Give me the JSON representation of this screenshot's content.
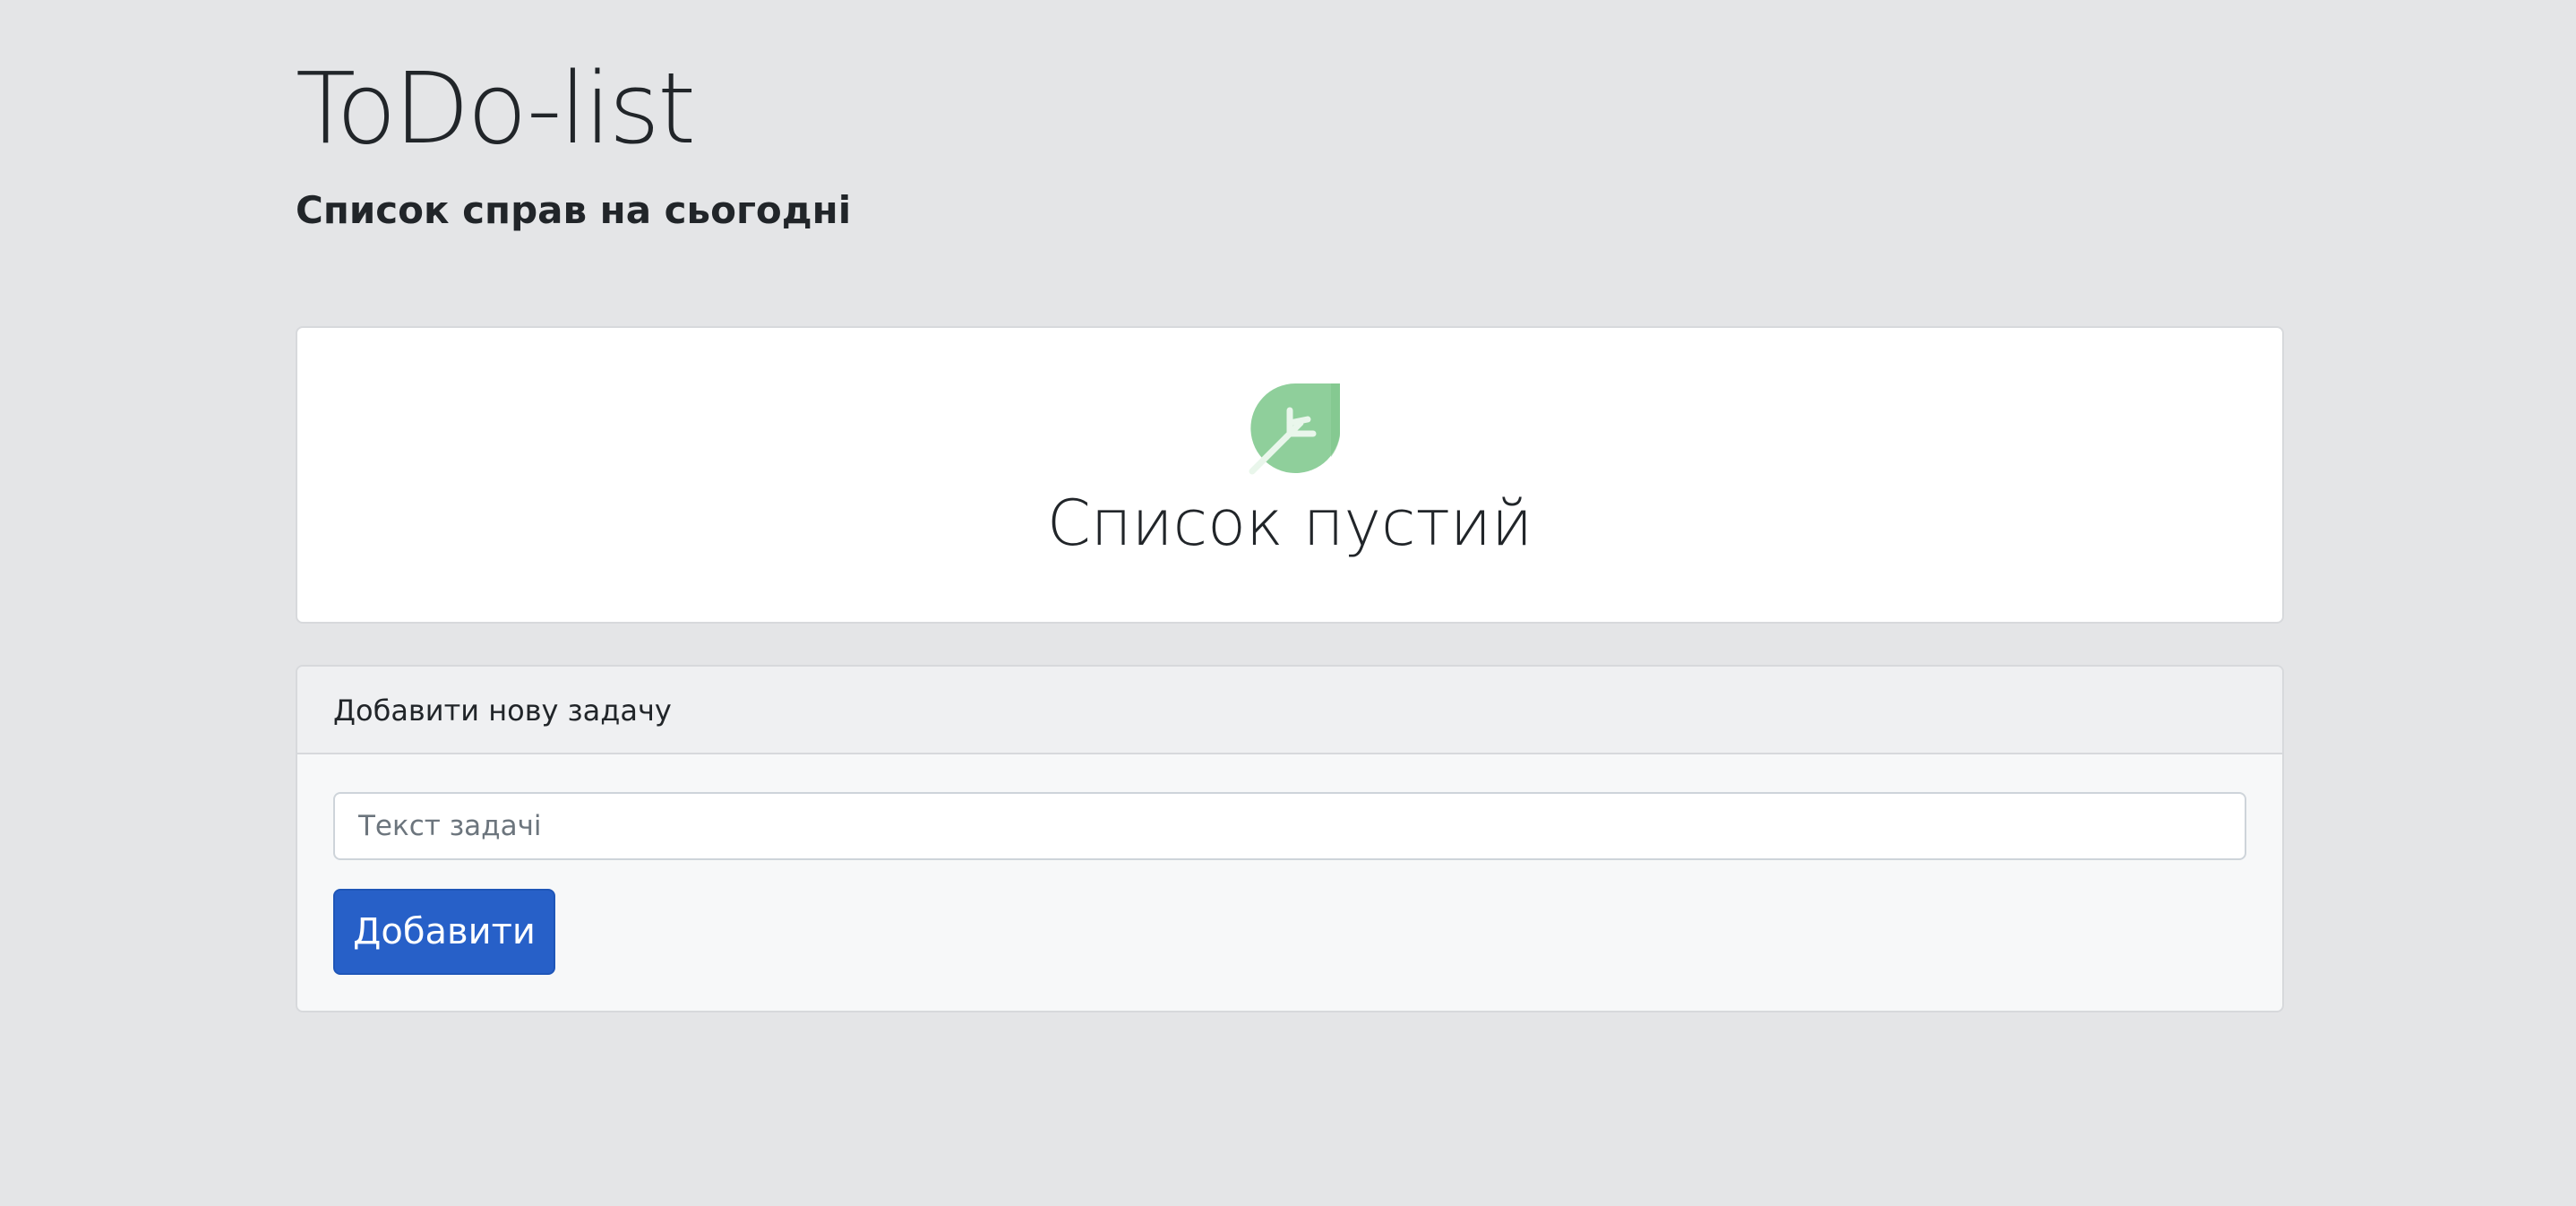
{
  "header": {
    "title": "ToDo-list",
    "subtitle": "Список справ на сьогодні"
  },
  "empty_state": {
    "icon": "leaf-icon",
    "text": "Список пустий",
    "icon_color": "#8fcf9b"
  },
  "add_task": {
    "header": "Добавити нову задачу",
    "input_placeholder": "Текст задачі",
    "input_value": "",
    "button_label": "Добавити"
  },
  "colors": {
    "background": "#e4e5e7",
    "primary_button": "#2760c8",
    "card_background": "#ffffff"
  }
}
